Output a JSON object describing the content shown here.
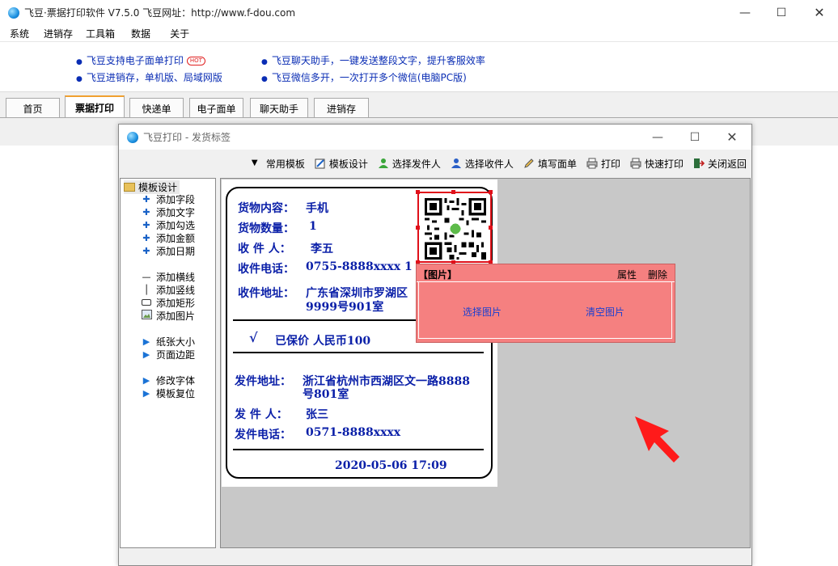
{
  "window": {
    "title": "飞豆·票据打印软件 V7.5.0   飞豆网址：http://www.f-dou.com"
  },
  "menu": [
    "系统",
    "进销存",
    "工具箱",
    "数据",
    "关于"
  ],
  "promos": [
    {
      "text": "飞豆支持电子面单打印",
      "badge": "HOT"
    },
    {
      "text": "飞豆进销存，单机版、局域网版"
    },
    {
      "text": "飞豆聊天助手，一键发送整段文字，提升客服效率"
    },
    {
      "text": "飞豆微信多开，一次打开多个微信(电脑PC版)"
    }
  ],
  "tabs": [
    {
      "label": "首页"
    },
    {
      "label": "票据打印",
      "active": true
    },
    {
      "label": "快递单"
    },
    {
      "label": "电子面单"
    },
    {
      "label": "聊天助手"
    },
    {
      "label": "进销存"
    }
  ],
  "subwindow": {
    "title": "飞豆打印 - 发货标签"
  },
  "toolbar": [
    {
      "label": "常用模板",
      "icon": "dropdown-triangle-icon"
    },
    {
      "label": "模板设计",
      "icon": "design-icon"
    },
    {
      "label": "选择发件人",
      "icon": "user-green-icon"
    },
    {
      "label": "选择收件人",
      "icon": "user-blue-icon"
    },
    {
      "label": "填写面单",
      "icon": "pencil-icon"
    },
    {
      "label": "打印",
      "icon": "printer-icon"
    },
    {
      "label": "快速打印",
      "icon": "printer-icon"
    },
    {
      "label": "关闭返回",
      "icon": "exit-icon"
    }
  ],
  "tree": {
    "root": "模板设计",
    "items": [
      {
        "label": "添加字段",
        "icon": "plus-icon"
      },
      {
        "label": "添加文字",
        "icon": "plus-icon"
      },
      {
        "label": "添加勾选",
        "icon": "plus-icon"
      },
      {
        "label": "添加金额",
        "icon": "plus-icon"
      },
      {
        "label": "添加日期",
        "icon": "plus-icon"
      },
      {
        "label": "添加横线",
        "icon": "hline-icon"
      },
      {
        "label": "添加竖线",
        "icon": "vline-icon"
      },
      {
        "label": "添加矩形",
        "icon": "rect-icon"
      },
      {
        "label": "添加图片",
        "icon": "image-icon"
      },
      {
        "label": "纸张大小",
        "icon": "triangle-icon"
      },
      {
        "label": "页面边距",
        "icon": "triangle-icon"
      },
      {
        "label": "修改字体",
        "icon": "triangle-icon"
      },
      {
        "label": "模板复位",
        "icon": "triangle-icon"
      }
    ]
  },
  "label": {
    "goods_label": "货物内容：",
    "goods": "手机",
    "qty_label": "货物数量：",
    "qty": "1",
    "receiver_label": "收 件 人：",
    "receiver": "李五",
    "receiver_phone_label": "收件电话：",
    "receiver_phone": "0755-8888xxxx 1",
    "receiver_addr_label": "收件地址：",
    "receiver_addr_line1": "广东省深圳市罗湖区",
    "receiver_addr_line2": "9999号901室",
    "check_mark": "√",
    "insured": "已保价 人民币100",
    "sender_addr_label": "发件地址：",
    "sender_addr_line1": "浙江省杭州市西湖区文一路8888",
    "sender_addr_line2": "号801室",
    "sender_label": "发 件 人：",
    "sender": "张三",
    "sender_phone_label": "发件电话：",
    "sender_phone": "0571-8888xxxx",
    "datetime": "2020-05-06 17:09"
  },
  "popup": {
    "title": "【图片】",
    "props": "属性",
    "delete": "删除",
    "select_image": "选择图片",
    "clear_image": "清空图片"
  },
  "colors": {
    "label_text": "#0a1fa8",
    "popup_bg": "#f58080",
    "selection": "#e0101a",
    "arrow": "#ff1a1a"
  }
}
